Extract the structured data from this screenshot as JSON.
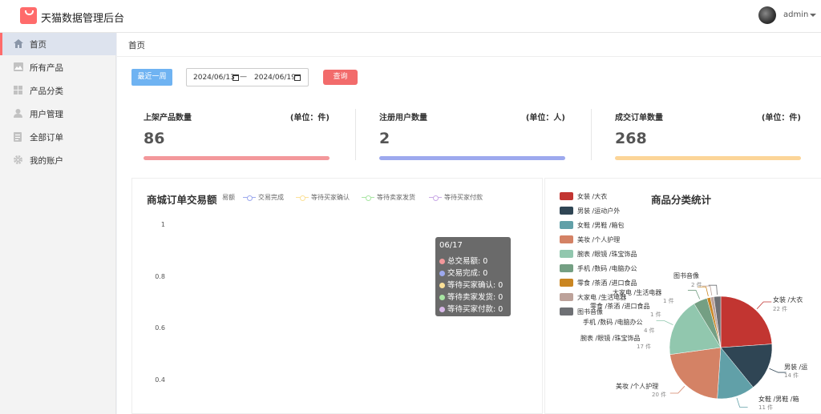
{
  "app": {
    "title": "天猫数据管理后台",
    "user": "admin"
  },
  "sidebar": {
    "items": [
      {
        "label": "首页",
        "icon": "home-icon",
        "active": true
      },
      {
        "label": "所有产品",
        "icon": "image-icon",
        "active": false
      },
      {
        "label": "产品分类",
        "icon": "grid-icon",
        "active": false
      },
      {
        "label": "用户管理",
        "icon": "user-icon",
        "active": false
      },
      {
        "label": "全部订单",
        "icon": "file-icon",
        "active": false
      },
      {
        "label": "我的账户",
        "icon": "gear-icon",
        "active": false
      }
    ]
  },
  "breadcrumb": "首页",
  "filter": {
    "recent_week_label": "最近一周",
    "start_date": "2024/06/13",
    "end_date": "2024/06/19",
    "separator": "—",
    "query_label": "查询"
  },
  "stats": [
    {
      "title": "上架产品数量",
      "unit": "(单位：件)",
      "value": "86",
      "color": "#f3989b"
    },
    {
      "title": "注册用户数量",
      "unit": "(单位：人)",
      "value": "2",
      "color": "#9da9ee"
    },
    {
      "title": "成交订单数量",
      "unit": "(单位：件)",
      "value": "268",
      "color": "#fcd598"
    }
  ],
  "order_chart": {
    "title": "商城订单交易额",
    "legend_cut": "易额",
    "legend": [
      {
        "name": "交易完成",
        "color": "#9da9ee"
      },
      {
        "name": "等待买家确认",
        "color": "#fce198"
      },
      {
        "name": "等待卖家发货",
        "color": "#a8e6a3"
      },
      {
        "name": "等待买家付款",
        "color": "#c9a8e6"
      }
    ],
    "y_ticks": [
      "1",
      "0.8",
      "0.6",
      "0.4"
    ],
    "tooltip": {
      "title": "06/17",
      "rows": [
        {
          "label": "总交易额: 0",
          "color": "#f3989b"
        },
        {
          "label": "交易完成: 0",
          "color": "#9da9ee"
        },
        {
          "label": "等待买家确认: 0",
          "color": "#fce198"
        },
        {
          "label": "等待卖家发货: 0",
          "color": "#a8e6a3"
        },
        {
          "label": "等待买家付款: 0",
          "color": "#d8b8e8"
        }
      ]
    }
  },
  "category_chart": {
    "title": "商品分类统计",
    "legend": [
      {
        "name": "女装 /大衣",
        "color": "#c23531"
      },
      {
        "name": "男装 /运动户外",
        "color": "#2f4554"
      },
      {
        "name": "女鞋 /男鞋 /箱包",
        "color": "#61a0a8"
      },
      {
        "name": "美妆 /个人护理",
        "color": "#d48265"
      },
      {
        "name": "腕表 /眼镜 /珠宝饰品",
        "color": "#91c7ae"
      },
      {
        "name": "手机 /数码 /电脑办公",
        "color": "#749f83"
      },
      {
        "name": "零食 /茶酒 /进口食品",
        "color": "#ca8622"
      },
      {
        "name": "大家电 /生活电器",
        "color": "#bda29a"
      },
      {
        "name": "图书音像",
        "color": "#6e7074"
      }
    ],
    "chart_data": {
      "type": "pie",
      "title": "商品分类统计",
      "categories": [
        "女装 /大衣",
        "男装 /运动户外",
        "女鞋 /男鞋 /箱包",
        "美妆 /个人护理",
        "腕表 /眼镜 /珠宝饰品",
        "手机 /数码 /电脑办公",
        "零食 /茶酒 /进口食品",
        "大家电 /生活电器",
        "图书音像"
      ],
      "values": [
        22,
        14,
        11,
        20,
        17,
        4,
        1,
        1,
        2
      ]
    },
    "labels": [
      {
        "text": "女装 /大衣",
        "count": "22 件"
      },
      {
        "text": "男装 /运",
        "count": "14 件"
      },
      {
        "text": "女鞋 /男鞋 /箱",
        "count": "11 件"
      },
      {
        "text": "美妆 /个人护理",
        "count": "20 件"
      },
      {
        "text": "腕表 /眼镜 /珠宝饰品",
        "count": "17 件"
      },
      {
        "text": "手机 /数码 /电脑办公",
        "count": "4 件"
      },
      {
        "text": "零食 /茶酒 /进口食品",
        "count": "1 件"
      },
      {
        "text": "大家电 /生活电器",
        "count": "1 件"
      },
      {
        "text": "图书音像",
        "count": "2 件"
      }
    ]
  }
}
